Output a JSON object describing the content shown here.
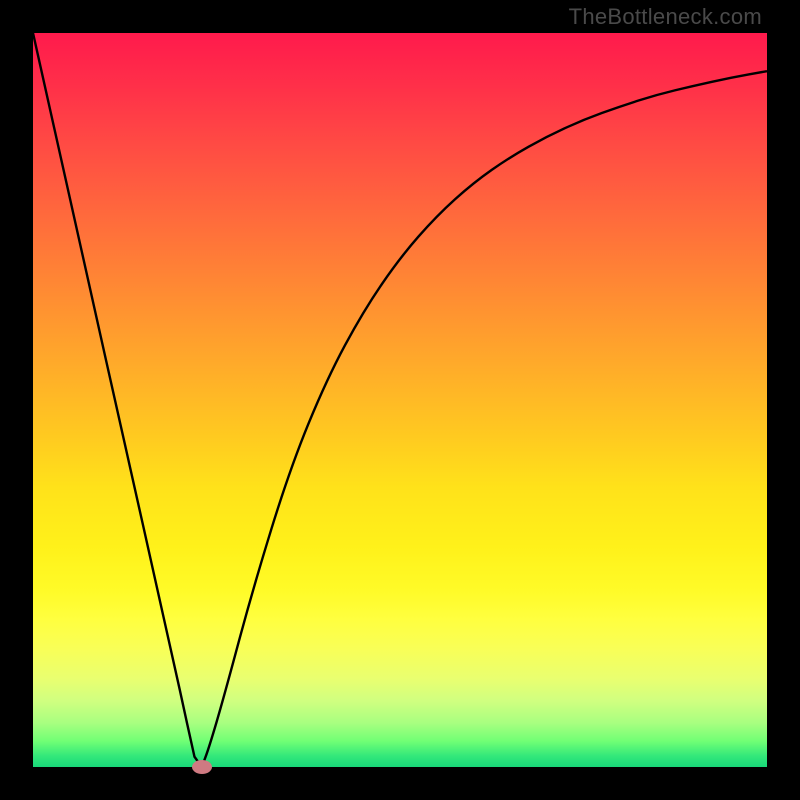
{
  "watermark": "TheBottleneck.com",
  "colors": {
    "frame": "#000000",
    "curve_stroke": "#000000",
    "marker": "#cf7a82",
    "gradient_top": "#ff1a4c",
    "gradient_bottom": "#18d879"
  },
  "chart_data": {
    "type": "line",
    "title": "",
    "xlabel": "",
    "ylabel": "",
    "xlim": [
      0,
      100
    ],
    "ylim": [
      0,
      100
    ],
    "series": [
      {
        "name": "bottleneck-curve",
        "x": [
          0,
          5,
          10,
          15,
          20,
          21,
          22,
          23,
          24,
          26,
          30,
          35,
          40,
          45,
          50,
          55,
          60,
          65,
          70,
          75,
          80,
          85,
          90,
          95,
          100
        ],
        "values": [
          100,
          77.6,
          55.2,
          32.9,
          10.5,
          5.9,
          1.4,
          0.0,
          2.7,
          9.5,
          24.4,
          40.6,
          52.8,
          62.1,
          69.4,
          75.1,
          79.6,
          83.1,
          85.9,
          88.2,
          90.0,
          91.6,
          92.8,
          93.9,
          94.8
        ]
      }
    ],
    "marker": {
      "x": 23,
      "y": 0
    },
    "annotations": []
  }
}
